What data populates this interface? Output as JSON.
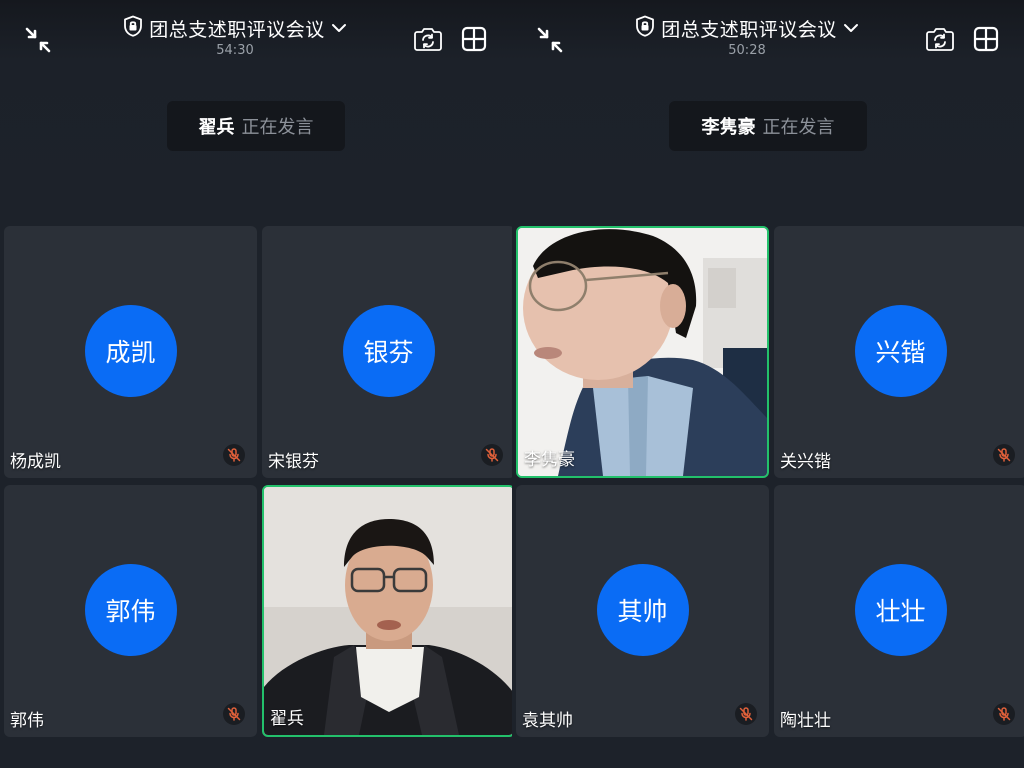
{
  "left": {
    "title": "团总支述职评议会议",
    "timer": "54:30",
    "speaker": {
      "name": "翟兵",
      "status": "正在发言"
    },
    "tiles": [
      {
        "name": "杨成凯",
        "avatar": "成凯",
        "muted": true
      },
      {
        "name": "宋银芬",
        "avatar": "银芬",
        "muted": true
      },
      {
        "name": "郭伟",
        "avatar": "郭伟",
        "muted": true
      },
      {
        "name": "翟兵",
        "video": true,
        "active": true
      }
    ]
  },
  "right": {
    "title": "团总支述职评议会议",
    "timer": "50:28",
    "speaker": {
      "name": "李隽豪",
      "status": "正在发言"
    },
    "tiles": [
      {
        "name": "李隽豪",
        "video": true,
        "active": true
      },
      {
        "name": "关兴锴",
        "avatar": "兴锴",
        "muted": true
      },
      {
        "name": "袁其帅",
        "avatar": "其帅",
        "muted": true
      },
      {
        "name": "陶壮壮",
        "avatar": "壮壮",
        "muted": true
      }
    ]
  },
  "colors": {
    "avatar": "#0a6cf5",
    "active_border": "#23c16b",
    "mute_icon": "#e0603a",
    "background": "#1d222a",
    "tile": "#2b3038"
  },
  "icons": {
    "exit_fullscreen": "shrink-arrows-icon",
    "security": "shield-lock-icon",
    "dropdown": "chevron-down-icon",
    "camera_switch": "camera-switch-icon",
    "layout": "grid-layout-icon",
    "mute": "mic-off-icon"
  }
}
